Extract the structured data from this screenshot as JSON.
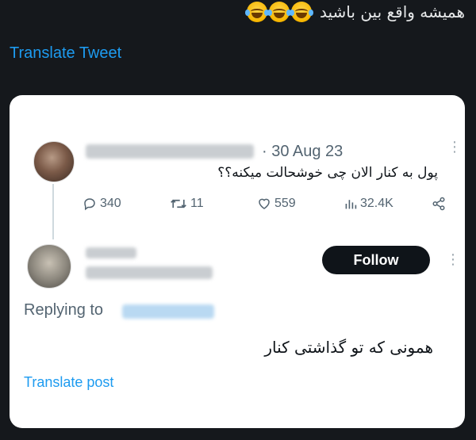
{
  "caption": {
    "text": "همیشه واقع بین باشید",
    "emojis": [
      "crying-laughing-emoji",
      "crying-laughing-emoji",
      "crying-laughing-emoji"
    ]
  },
  "translate_tweet": "Translate Tweet",
  "quoted_post": {
    "date": "· 30 Aug 23",
    "text": "پول به کنار الان چی خوشحالت میکنه؟؟",
    "replies": "340",
    "reposts": "11",
    "likes": "559",
    "views": "32.4K"
  },
  "reply_post": {
    "follow_label": "Follow",
    "replying_to": "Replying to",
    "text": "همونی که تو گذاشتی کنار",
    "translate_label": "Translate post"
  },
  "colors": {
    "background": "#15181c",
    "card": "#ffffff",
    "link": "#1d9bf0",
    "muted": "#536471",
    "button": "#0f1419"
  }
}
